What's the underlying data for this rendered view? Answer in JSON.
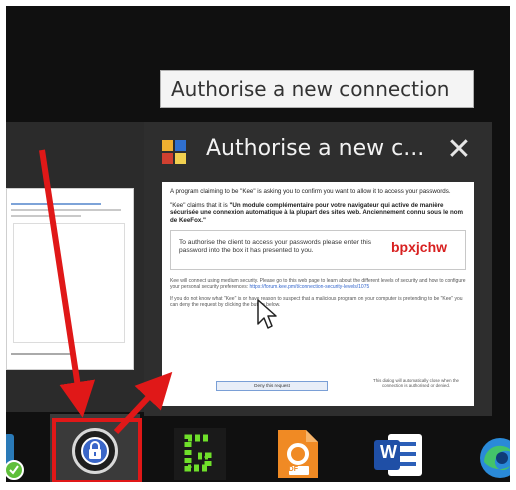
{
  "tooltip": {
    "text": "Authorise a new connection"
  },
  "thumbnail": {
    "title": "Authorise a new c...",
    "close_glyph": "✕",
    "app_icon": "keepass-icon",
    "content": {
      "intro": "A program claiming to be \"Kee\" is asking you to confirm you want to allow it to access your passwords.",
      "claim_prefix": "\"Kee\" claims that it is",
      "claim_bold": "\"Un module complémentaire pour votre navigateur qui active de manière sécurisée une connexion automatique à la plupart des sites web. Anciennement connu sous le nom de KeeFox.\"",
      "box_text": "To authorise the client to access your passwords please enter this password into the box it has presented to you.",
      "code": "bpxjchw",
      "security_note": "Kee will connect using medium security. Please go to this web page to learn about the different levels of security and how to configure your personal security preferences:",
      "security_link": "https://forum.kee.pm/t/connection-security-levels/1075",
      "warning": "If you do not know what \"Kee\" is or have reason to suspect that a malicious program on your computer is pretending to be \"Kee\" you can deny the request by clicking the button below.",
      "deny_button": "Deny this request",
      "footer_note": "This dialog will automatically close when the connection is authorised or denied."
    }
  },
  "taskbar": {
    "icons": [
      {
        "name": "app-partial-icon"
      },
      {
        "name": "keepass-icon",
        "highlighted": true
      },
      {
        "name": "gmail-notifier-icon"
      },
      {
        "name": "pdf-app-icon",
        "label": "PDF"
      },
      {
        "name": "word-icon",
        "label": "W"
      },
      {
        "name": "edge-icon"
      }
    ]
  },
  "colors": {
    "taskbar_bg": "#101010",
    "thumb_bg": "#2e2e2e",
    "annotation_red": "#e01818",
    "code_red": "#d82020"
  }
}
